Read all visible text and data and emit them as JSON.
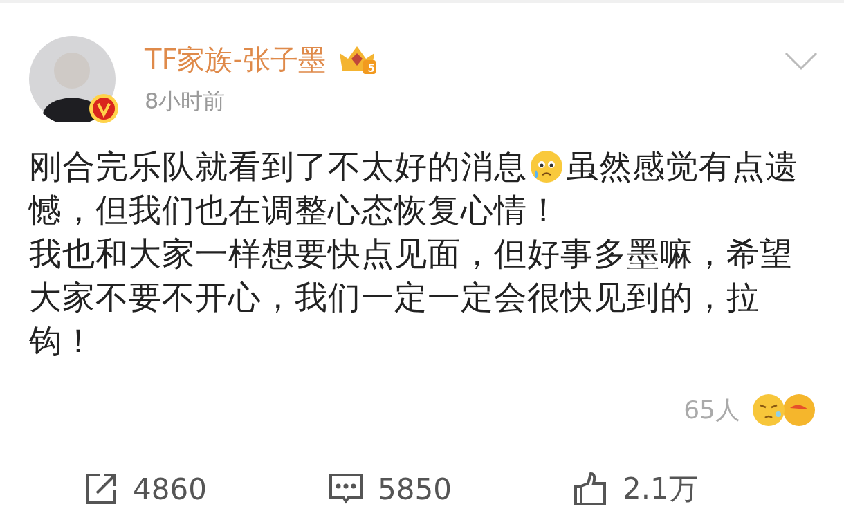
{
  "post": {
    "author": {
      "name": "TF家族-张子墨",
      "verified": true,
      "level_badge": "5"
    },
    "time": "8小时前",
    "lines": [
      [
        {
          "kind": "text",
          "text": "刚合完乐队就看到了不太好的消息"
        },
        {
          "kind": "emoji"
        },
        {
          "kind": "text",
          "text": "虽然感觉有点遗"
        }
      ],
      [
        {
          "kind": "text",
          "text": "憾，但我们也在调整心态恢复心情！"
        }
      ],
      [
        {
          "kind": "text",
          "text": "我也和大家一样想要快点见面，但好事多墨嘛，希望"
        }
      ],
      [
        {
          "kind": "text",
          "text": "大家不要不开心，我们一定一定会很快见到的，拉"
        }
      ],
      [
        {
          "kind": "text",
          "text": "钩！"
        }
      ]
    ],
    "reactions": {
      "count": "65人"
    },
    "actions": [
      {
        "kind": "share",
        "count": "4860"
      },
      {
        "kind": "comment",
        "count": "5850"
      },
      {
        "kind": "like",
        "count": "2.1万"
      }
    ]
  }
}
